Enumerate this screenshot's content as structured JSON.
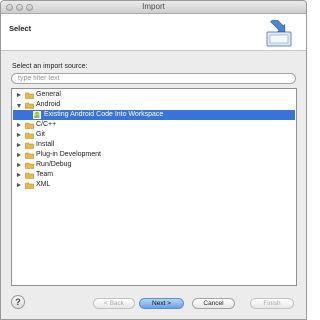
{
  "window": {
    "title": "Import"
  },
  "header": {
    "title": "Select"
  },
  "prompt": "Select an import source:",
  "filter": {
    "placeholder": "type filter text",
    "value": ""
  },
  "tree": [
    {
      "label": "General",
      "kind": "folder",
      "state": "collapsed",
      "depth": 0
    },
    {
      "label": "Android",
      "kind": "folder",
      "state": "expanded",
      "depth": 0
    },
    {
      "label": "Existing Android Code Into Workspace",
      "kind": "android",
      "state": "leaf",
      "depth": 1,
      "selected": true
    },
    {
      "label": "C/C++",
      "kind": "folder",
      "state": "collapsed",
      "depth": 0
    },
    {
      "label": "Git",
      "kind": "folder",
      "state": "collapsed",
      "depth": 0
    },
    {
      "label": "Install",
      "kind": "folder",
      "state": "collapsed",
      "depth": 0
    },
    {
      "label": "Plug-in Development",
      "kind": "folder",
      "state": "collapsed",
      "depth": 0
    },
    {
      "label": "Run/Debug",
      "kind": "folder",
      "state": "collapsed",
      "depth": 0
    },
    {
      "label": "Team",
      "kind": "folder",
      "state": "collapsed",
      "depth": 0
    },
    {
      "label": "XML",
      "kind": "folder",
      "state": "collapsed",
      "depth": 0
    }
  ],
  "buttons": {
    "help": "?",
    "back": "< Back",
    "next": "Next >",
    "cancel": "Cancel",
    "finish": "Finish"
  },
  "colors": {
    "selection": "#3874d8",
    "folder": "#e8b84a",
    "android": "#9fbf3b"
  }
}
